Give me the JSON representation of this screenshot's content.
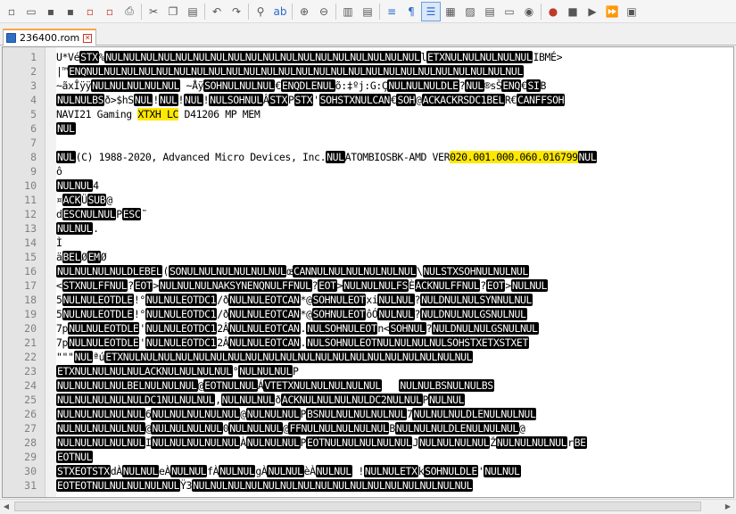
{
  "toolbar": {
    "icons": [
      "new-file",
      "open-file",
      "save",
      "save-all",
      "close",
      "close-all",
      "print",
      "cut",
      "copy",
      "paste",
      "undo",
      "redo",
      "find",
      "replace",
      "zoom-in",
      "zoom-out",
      "sync-vertical",
      "sync-horizontal",
      "word-wrap",
      "show-all-chars",
      "indent-guide",
      "user-defined-language",
      "doc-map",
      "function-list",
      "folder-as-workspace",
      "monitor",
      "record-macro",
      "stop-macro",
      "play-macro",
      "run-macro-multiple",
      "save-macro"
    ]
  },
  "tab": {
    "label": "236400.rom"
  },
  "colors": {
    "highlight": "#ffe800",
    "control_bg": "#000000",
    "tab_accent": "#f9a64a"
  },
  "lines": [
    {
      "n": "1",
      "segments": [
        {
          "t": "U"
        },
        {
          "t": "*Vé"
        },
        {
          "t": "STX",
          "c": 1
        },
        {
          "t": "%"
        },
        {
          "t": "NULNULNULNULNULNULNULNULNULNULNULNULNULNULNULNULNULNUL",
          "c": 1
        },
        {
          "t": "l"
        },
        {
          "t": "ETXNULNULNULNULNUL",
          "c": 1
        },
        {
          "t": "IBMÉ>"
        }
      ]
    },
    {
      "n": "2",
      "segments": [
        {
          "t": "|™"
        },
        {
          "t": "ENQNULNULNULNULNULNULNULNULNULNULNULNULNULNULNULNULNULNULNULNULNULNULNULNULNUL",
          "c": 1
        }
      ]
    },
    {
      "n": "3",
      "segments": [
        {
          "t": "~ãxÎÿÿ"
        },
        {
          "t": "NULNULNULNULNUL",
          "c": 1
        },
        {
          "t": " ~Åÿ"
        },
        {
          "t": "SOHNULNULNUL",
          "c": 1
        },
        {
          "t": "€"
        },
        {
          "t": "ENQDLENUL",
          "c": 1
        },
        {
          "t": "õ:‡ºj:G:Ç"
        },
        {
          "t": "NULNULNULDLE",
          "c": 1
        },
        {
          "t": "?"
        },
        {
          "t": "NUL",
          "c": 1
        },
        {
          "t": "®sŠ"
        },
        {
          "t": "ENQ",
          "c": 1
        },
        {
          "t": "€"
        },
        {
          "t": "SI",
          "c": 1
        },
        {
          "t": "B"
        }
      ]
    },
    {
      "n": "4",
      "segments": [
        {
          "t": "NULNULBS",
          "c": 1
        },
        {
          "t": "ð>$hS"
        },
        {
          "t": "NUL",
          "c": 1
        },
        {
          "t": "!"
        },
        {
          "t": "NUL",
          "c": 1
        },
        {
          "t": "!"
        },
        {
          "t": "NUL",
          "c": 1
        },
        {
          "t": "!"
        },
        {
          "t": "NULSOHNUL",
          "c": 1
        },
        {
          "t": "Â"
        },
        {
          "t": "STX",
          "c": 1
        },
        {
          "t": "P"
        },
        {
          "t": "STX",
          "c": 1
        },
        {
          "t": "'"
        },
        {
          "t": "SOHSTXNULCAN",
          "c": 1
        },
        {
          "t": "€"
        },
        {
          "t": "SOH",
          "c": 1
        },
        {
          "t": "@"
        },
        {
          "t": "ACKACKRSDC1BEL",
          "c": 1
        },
        {
          "t": "R€"
        },
        {
          "t": "CANFFSOH",
          "c": 1
        }
      ]
    },
    {
      "n": "5",
      "segments": [
        {
          "t": "NAVI21 Gaming "
        },
        {
          "t": "XTXH LC",
          "h": 1
        },
        {
          "t": " D41206 MP MEM"
        }
      ]
    },
    {
      "n": "6",
      "segments": [
        {
          "t": "NUL",
          "c": 1
        }
      ]
    },
    {
      "n": "7",
      "segments": []
    },
    {
      "n": "8",
      "segments": [
        {
          "t": "NUL",
          "c": 1
        },
        {
          "t": "(C) 1988-2020, Advanced Micro Devices, Inc."
        },
        {
          "t": "NUL",
          "c": 1
        },
        {
          "t": "ATOMBIOSBK-AMD VER"
        },
        {
          "t": "020.001.000.060.016799",
          "h": 1
        },
        {
          "t": "NUL",
          "c": 1
        }
      ]
    },
    {
      "n": "9",
      "segments": [
        {
          "t": "ô"
        }
      ]
    },
    {
      "n": "10",
      "segments": [
        {
          "t": "NULNUL",
          "c": 1
        },
        {
          "t": "4"
        }
      ]
    },
    {
      "n": "11",
      "segments": [
        {
          "t": "¤"
        },
        {
          "t": "ACK",
          "c": 1
        },
        {
          "t": "Ü"
        },
        {
          "t": "SUB",
          "c": 1
        },
        {
          "t": "@"
        }
      ]
    },
    {
      "n": "12",
      "segments": [
        {
          "t": "d"
        },
        {
          "t": "ESCNULNUL",
          "c": 1
        },
        {
          "t": "P"
        },
        {
          "t": "ESC",
          "c": 1
        },
        {
          "t": "˜"
        }
      ]
    },
    {
      "n": "13",
      "segments": [
        {
          "t": "NULNUL",
          "c": 1
        },
        {
          "t": "."
        }
      ]
    },
    {
      "n": "14",
      "segments": [
        {
          "t": "Ì"
        }
      ]
    },
    {
      "n": "15",
      "segments": [
        {
          "t": "ä"
        },
        {
          "t": "BEL",
          "c": 1
        },
        {
          "t": "Ø"
        },
        {
          "t": "EM",
          "c": 1
        },
        {
          "t": "Ø"
        }
      ]
    },
    {
      "n": "16",
      "segments": [
        {
          "t": "NULNULNULNULDLEBEL",
          "c": 1
        },
        {
          "t": "("
        },
        {
          "t": "SONULNULNULNULNULNUL",
          "c": 1
        },
        {
          "t": "œ"
        },
        {
          "t": "CANNULNULNULNULNULNUL",
          "c": 1
        },
        {
          "t": "\\"
        },
        {
          "t": "NULSTXSOHNULNULNUL",
          "c": 1
        }
      ]
    },
    {
      "n": "17",
      "segments": [
        {
          "t": "<"
        },
        {
          "t": "STXNULFFNUL",
          "c": 1
        },
        {
          "t": "?"
        },
        {
          "t": "EOT",
          "c": 1
        },
        {
          "t": ">"
        },
        {
          "t": "NULNULNULNAKSYNENQNULFFNUL",
          "c": 1
        },
        {
          "t": "?"
        },
        {
          "t": "EOT",
          "c": 1
        },
        {
          "t": ">"
        },
        {
          "t": "NULNULNULFS",
          "c": 1
        },
        {
          "t": "È"
        },
        {
          "t": "ACKNULFFNUL",
          "c": 1
        },
        {
          "t": "?"
        },
        {
          "t": "EOT",
          "c": 1
        },
        {
          "t": ">"
        },
        {
          "t": "NULNUL",
          "c": 1
        }
      ]
    },
    {
      "n": "18",
      "segments": [
        {
          "t": "5"
        },
        {
          "t": "NULNULEOTDLE",
          "c": 1
        },
        {
          "t": "!°"
        },
        {
          "t": "NULNULEOTDC1",
          "c": 1
        },
        {
          "t": "/ð"
        },
        {
          "t": "NULNULEOTCAN",
          "c": 1
        },
        {
          "t": "*@"
        },
        {
          "t": "SOHNULEOT",
          "c": 1
        },
        {
          "t": "xi"
        },
        {
          "t": "NULNUL",
          "c": 1
        },
        {
          "t": "?"
        },
        {
          "t": "NULDNULNULSYNNULNUL",
          "c": 1
        }
      ]
    },
    {
      "n": "19",
      "segments": [
        {
          "t": "5"
        },
        {
          "t": "NULNULEOTDLE",
          "c": 1
        },
        {
          "t": "!°"
        },
        {
          "t": "NULNULEOTDC1",
          "c": 1
        },
        {
          "t": "/ð"
        },
        {
          "t": "NULNULEOTCAN",
          "c": 1
        },
        {
          "t": "*@"
        },
        {
          "t": "SOHNULEOT",
          "c": 1
        },
        {
          "t": "ôÓ"
        },
        {
          "t": "NULNUL",
          "c": 1
        },
        {
          "t": "?"
        },
        {
          "t": "NULDNULNULGSNULNUL",
          "c": 1
        }
      ]
    },
    {
      "n": "20",
      "segments": [
        {
          "t": "7p"
        },
        {
          "t": "NULNULEOTDLE",
          "c": 1
        },
        {
          "t": "'"
        },
        {
          "t": "NULNULEOTDC1",
          "c": 1
        },
        {
          "t": "2Â"
        },
        {
          "t": "NULNULEOTCAN",
          "c": 1
        },
        {
          "t": "."
        },
        {
          "t": "NULSOHNULEOT",
          "c": 1
        },
        {
          "t": "n<"
        },
        {
          "t": "SOHNUL",
          "c": 1
        },
        {
          "t": "?"
        },
        {
          "t": "NULDNULNULGSNULNUL",
          "c": 1
        }
      ]
    },
    {
      "n": "21",
      "segments": [
        {
          "t": "7p"
        },
        {
          "t": "NULNULEOTDLE",
          "c": 1
        },
        {
          "t": "'"
        },
        {
          "t": "NULNULEOTDC1",
          "c": 1
        },
        {
          "t": "2Â"
        },
        {
          "t": "NULNULEOTCAN",
          "c": 1
        },
        {
          "t": "."
        },
        {
          "t": "NULSOHNULEOTNULNULNULNULSOHSTXETXSTXET",
          "c": 1
        }
      ]
    },
    {
      "n": "22",
      "segments": [
        {
          "t": "\"\"\""
        },
        {
          "t": "NUL",
          "c": 1
        },
        {
          "t": "ªú"
        },
        {
          "t": "ETXNULNULNULNULNULNULNULNULNULNULNULNULNULNULNULNULNULNULNULNUL",
          "c": 1
        }
      ]
    },
    {
      "n": "23",
      "segments": [
        {
          "t": "ETXNULNULNULNULACKNULNULNULNUL",
          "c": 1
        },
        {
          "t": "°"
        },
        {
          "t": "NULNULNUL",
          "c": 1
        },
        {
          "t": "P"
        }
      ]
    },
    {
      "n": "24",
      "segments": [
        {
          "t": "NULNULNULNULBELNULNULNUL",
          "c": 1
        },
        {
          "t": "@"
        },
        {
          "t": "EOTNULNUL",
          "c": 1
        },
        {
          "t": "Á"
        },
        {
          "t": "VTETXNULNULNULNULNUL",
          "c": 1
        },
        {
          "t": "   "
        },
        {
          "t": "NULNULBSNULNULBS",
          "c": 1
        }
      ]
    },
    {
      "n": "25",
      "segments": [
        {
          "t": "NULNULNULNULNULDC1NULNULNUL",
          "c": 1
        },
        {
          "t": ","
        },
        {
          "t": "NULNULNUL",
          "c": 1
        },
        {
          "t": "ð"
        },
        {
          "t": "ACKNULNULNULNULDC2NULNUL",
          "c": 1
        },
        {
          "t": "P"
        },
        {
          "t": "NULNUL",
          "c": 1
        }
      ]
    },
    {
      "n": "26",
      "segments": [
        {
          "t": "NULNULNULNULNUL",
          "c": 1
        },
        {
          "t": "6"
        },
        {
          "t": "NULNULNULNULNUL",
          "c": 1
        },
        {
          "t": "@"
        },
        {
          "t": "NULNULNUL",
          "c": 1
        },
        {
          "t": "P"
        },
        {
          "t": "BSNULNULNULNULNUL",
          "c": 1
        },
        {
          "t": "7"
        },
        {
          "t": "NULNULNULDLENULNULNUL",
          "c": 1
        }
      ]
    },
    {
      "n": "27",
      "segments": [
        {
          "t": "NULNULNULNULNUL",
          "c": 1
        },
        {
          "t": "@"
        },
        {
          "t": "NULNULNULNUL",
          "c": 1
        },
        {
          "t": "0"
        },
        {
          "t": "NULNULNUL",
          "c": 1
        },
        {
          "t": "@"
        },
        {
          "t": "FFNULNULNULNULNUL",
          "c": 1
        },
        {
          "t": "B"
        },
        {
          "t": "NULNULNULDLENULNULNUL",
          "c": 1
        },
        {
          "t": "@"
        }
      ]
    },
    {
      "n": "28",
      "segments": [
        {
          "t": "NULNULNULNULNUL",
          "c": 1
        },
        {
          "t": "I"
        },
        {
          "t": "NULNULNULNULNUL",
          "c": 1
        },
        {
          "t": "À"
        },
        {
          "t": "NULNULNUL",
          "c": 1
        },
        {
          "t": "P"
        },
        {
          "t": "EOTNULNULNULNULNUL",
          "c": 1
        },
        {
          "t": "J"
        },
        {
          "t": "NULNULNULNUL",
          "c": 1
        },
        {
          "t": "Ž"
        },
        {
          "t": "NULNULNULNUL",
          "c": 1
        },
        {
          "t": "r"
        },
        {
          "t": "BE",
          "c": 1
        }
      ]
    },
    {
      "n": "29",
      "segments": [
        {
          "t": "EOTNUL",
          "c": 1
        }
      ]
    },
    {
      "n": "30",
      "segments": [
        {
          "t": "STXEOTSTX",
          "c": 1
        },
        {
          "t": "dÀ"
        },
        {
          "t": "NULNUL",
          "c": 1
        },
        {
          "t": "eÀ"
        },
        {
          "t": "NULNUL",
          "c": 1
        },
        {
          "t": "fÀ"
        },
        {
          "t": "NULNUL",
          "c": 1
        },
        {
          "t": "gÀ"
        },
        {
          "t": "NULNUL",
          "c": 1
        },
        {
          "t": "èÀ"
        },
        {
          "t": "NULNUL",
          "c": 1
        },
        {
          "t": " !"
        },
        {
          "t": "NULNULETX",
          "c": 1
        },
        {
          "t": "k"
        },
        {
          "t": "SOHNULDLE",
          "c": 1
        },
        {
          "t": "'"
        },
        {
          "t": "NULNUL",
          "c": 1
        }
      ]
    },
    {
      "n": "31",
      "segments": [
        {
          "t": "EOTEOTNULNULNULNULNUL",
          "c": 1
        },
        {
          "t": "Ÿ3"
        },
        {
          "t": "NULNULNULNULNULNULNULNULNULNULNULNULNULNULNULNUL",
          "c": 1
        }
      ]
    }
  ]
}
